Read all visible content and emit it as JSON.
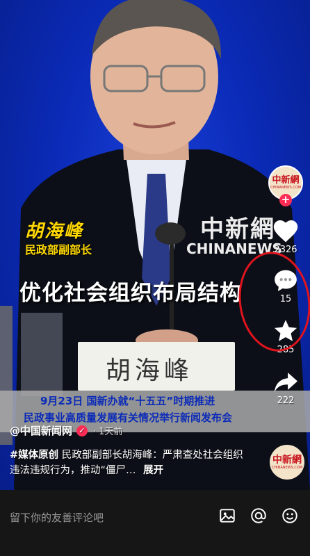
{
  "video": {
    "speaker_name": "胡海峰",
    "speaker_title": "民政部副部长",
    "headline": "优化社会组织布局结构",
    "watermark_cn": "中新網",
    "watermark_en": "CHINANEWS",
    "nameplate": "胡海峰",
    "banner_line1": "9月23日 国新办就“十五五”时期推进",
    "banner_line2": "民政事业高质量发展有关情况举行新闻发布会"
  },
  "sidebar": {
    "avatar_text": "中新網",
    "avatar_sub": "CHINANEWS.COM",
    "follow_symbol": "+",
    "like_count": "2326",
    "comment_count": "15",
    "favorite_count": "285",
    "share_count": "222"
  },
  "post": {
    "author": "@中国新闻网",
    "verified_symbol": "✓",
    "time": "· 1天前",
    "tag": "#媒体原创",
    "caption_text": "民政部副部长胡海峰：严肃查处社会组织违法违规行为，推动“僵尸…",
    "expand": "展开"
  },
  "comment_bar": {
    "placeholder": "留下你的友善评论吧"
  },
  "colors": {
    "background_blue": "#0b2bb8",
    "caption_yellow": "#ffd800",
    "accent_red": "#fe2c55",
    "annotation_red": "#e0141e"
  }
}
